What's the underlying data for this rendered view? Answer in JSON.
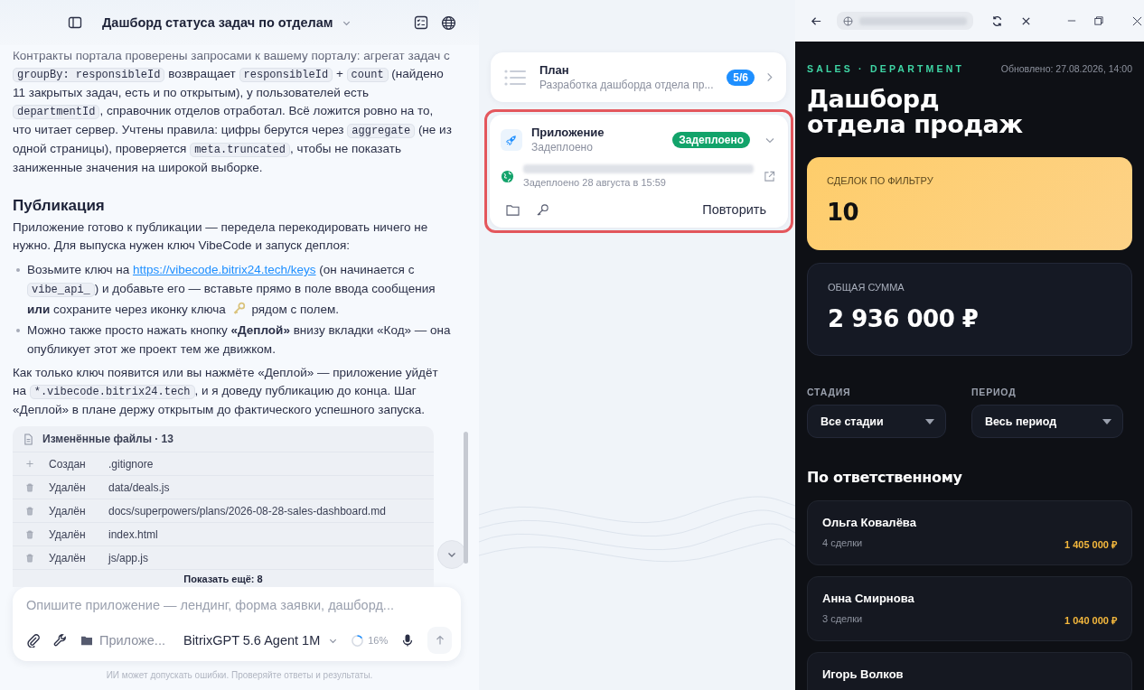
{
  "header": {
    "title": "Дашборд статуса задач по отделам"
  },
  "message": [
    {
      "kind": "paragraph",
      "segments": [
        {
          "kind": "text",
          "text": "Контракты портала проверены запросами к вашему порталу: агрегат задач с "
        },
        {
          "kind": "code",
          "text": "groupBy: responsibleId"
        },
        {
          "kind": "text",
          "text": " возвращает "
        },
        {
          "kind": "code",
          "text": "responsibleId"
        },
        {
          "kind": "text",
          "text": " + "
        },
        {
          "kind": "code",
          "text": "count"
        },
        {
          "kind": "text",
          "text": " (найдено 11 закрытых задач, есть и по открытым), у пользователей есть "
        },
        {
          "kind": "code",
          "text": "departmentId"
        },
        {
          "kind": "text",
          "text": ", справочник отделов отработал. Всё ложится ровно на то, что читает сервер. Учтены правила: цифры берутся через "
        },
        {
          "kind": "code",
          "text": "aggregate"
        },
        {
          "kind": "text",
          "text": " (не из одной страницы), проверяется "
        },
        {
          "kind": "code",
          "text": "meta.truncated"
        },
        {
          "kind": "text",
          "text": ", чтобы не показать заниженные значения на широкой выборке."
        }
      ]
    },
    {
      "kind": "heading",
      "text": "Публикация"
    },
    {
      "kind": "paragraph",
      "segments": [
        {
          "kind": "text",
          "text": "Приложение готово к публикации — передела перекодировать ничего не нужно. Для выпуска нужен ключ VibeCode и запуск деплоя:"
        }
      ]
    },
    {
      "kind": "list",
      "items": [
        [
          {
            "kind": "text",
            "text": "Возьмите ключ на "
          },
          {
            "kind": "link",
            "text": "https://vibecode.bitrix24.tech/keys"
          },
          {
            "kind": "text",
            "text": " (он начинается с "
          },
          {
            "kind": "code",
            "text": "vibe_api_"
          },
          {
            "kind": "text",
            "text": ") и добавьте его — вставьте прямо в поле ввода сообщения "
          },
          {
            "kind": "bold",
            "text": "или"
          },
          {
            "kind": "text",
            "text": " сохраните через иконку ключа "
          },
          {
            "kind": "icon"
          },
          {
            "kind": "text",
            "text": " рядом с полем."
          }
        ],
        [
          {
            "kind": "text",
            "text": "Можно также просто нажать кнопку "
          },
          {
            "kind": "bold",
            "text": "«Деплой»"
          },
          {
            "kind": "text",
            "text": " внизу вкладки «Код» — она опубликует этот же проект тем же движком."
          }
        ]
      ]
    },
    {
      "kind": "paragraph",
      "segments": [
        {
          "kind": "text",
          "text": "Как только ключ появится или вы нажмёте «Деплой» — приложение уйдёт на "
        },
        {
          "kind": "code",
          "text": "*.vibecode.bitrix24.tech"
        },
        {
          "kind": "text",
          "text": ", и я доведу публикацию до конца. Шаг «Деплой» в плане держу открытым до фактического успешного запуска."
        }
      ]
    }
  ],
  "changed_files": {
    "title": "Изменённые файлы · 13",
    "more": "Показать ещё: 8",
    "files": [
      {
        "kind": "created",
        "action": "Создан",
        "path": ".gitignore"
      },
      {
        "kind": "deleted",
        "action": "Удалён",
        "path": "data/deals.js"
      },
      {
        "kind": "deleted",
        "action": "Удалён",
        "path": "docs/superpowers/plans/2026-08-28-sales-dashboard.md"
      },
      {
        "kind": "deleted",
        "action": "Удалён",
        "path": "index.html"
      },
      {
        "kind": "deleted",
        "action": "Удалён",
        "path": "js/app.js"
      }
    ]
  },
  "composer": {
    "placeholder": "Опишите приложение — лендинг, форма заявки, дашборд...",
    "project": "Приложе...",
    "model": "BitrixGPT 5.6 Agent 1M",
    "context": {
      "level": 0.16,
      "reading": "16%"
    }
  },
  "disclaimer": "ИИ может допускать ошибки. Проверяйте ответы и результаты.",
  "plan_card": {
    "title": "План",
    "subtitle": "Разработка дашборда отдела пр...",
    "badge": "5/6"
  },
  "app_card": {
    "title": "Приложение",
    "subtitle": "Задеплоено",
    "status": "Задеплоено",
    "highlighted": true,
    "deployed_at": "Задеплоено 28 августа в 15:59",
    "action": "Повторить"
  },
  "dashboard": {
    "eyebrow": "SALES · DEPARTMENT",
    "updated": "Обновлено: 27.08.2026, 14:00",
    "title_lines": [
      "Дашборд",
      "отдела продаж"
    ],
    "kpis": [
      {
        "kind": "accent",
        "label": "СДЕЛОК ПО ФИЛЬТРУ",
        "value": "10"
      },
      {
        "kind": "plain",
        "label": "ОБЩАЯ СУММА",
        "value": "2 936 000 ₽"
      }
    ],
    "filters": [
      {
        "label": "СТАДИЯ",
        "value": "Все стадии"
      },
      {
        "label": "ПЕРИОД",
        "value": "Весь период"
      }
    ],
    "section": "По ответственному",
    "people": [
      {
        "name": "Ольга Ковалёва",
        "deals": "4 сделки",
        "amount": "1 405 000 ₽"
      },
      {
        "name": "Анна Смирнова",
        "deals": "3 сделки",
        "amount": "1 040 000 ₽"
      },
      {
        "name": "Игорь Волков"
      }
    ]
  }
}
